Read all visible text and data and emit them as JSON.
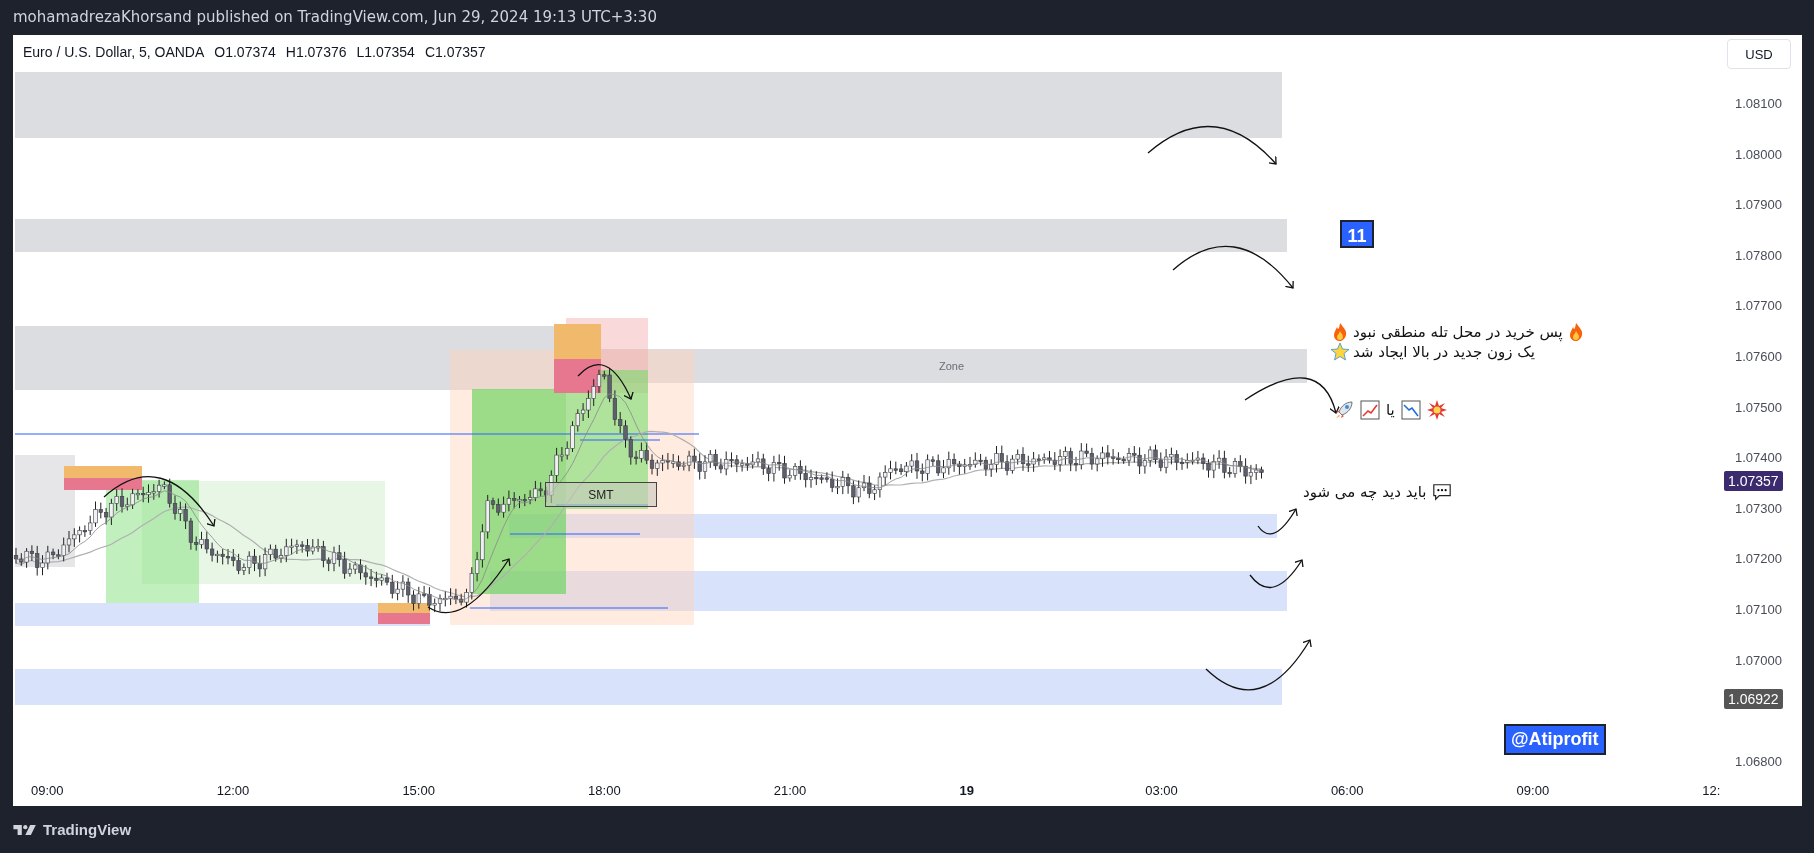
{
  "header": {
    "text": "mohamadrezaKhorsand published on TradingView.com, Jun 29, 2024 19:13 UTC+3:30"
  },
  "legend": {
    "symbol": "Euro / U.S. Dollar, 5, OANDA",
    "ohlc": [
      "O1.07374",
      "H1.07376",
      "L1.07354",
      "C1.07357"
    ]
  },
  "currency_button": "USD",
  "zone_label": "Zone",
  "smt_label": "SMT",
  "annotations": {
    "count_badge": "11",
    "line_1": "پس خرید در محل تله منطقی نبود",
    "line_2": "یک زون جدید در بالا ایجاد شد",
    "or_word": "یا",
    "line_4": "باید دید چه می شود",
    "handle": "@Atiprofit"
  },
  "price_axis": [
    "1.08100",
    "1.08000",
    "1.07900",
    "1.07800",
    "1.07700",
    "1.07600",
    "1.07500",
    "1.07400",
    "1.07300",
    "1.07200",
    "1.07100",
    "1.07000",
    "1.06800"
  ],
  "price_badges": [
    {
      "label": "1.07357",
      "color": "#3b2a6e"
    },
    {
      "label": "1.06922",
      "color": "#555555"
    }
  ],
  "time_axis": [
    {
      "label": "09:00",
      "kind": "time"
    },
    {
      "label": "12:00",
      "kind": "time"
    },
    {
      "label": "15:00",
      "kind": "time"
    },
    {
      "label": "18:00",
      "kind": "time"
    },
    {
      "label": "21:00",
      "kind": "time"
    },
    {
      "label": "19",
      "kind": "day"
    },
    {
      "label": "03:00",
      "kind": "time"
    },
    {
      "label": "06:00",
      "kind": "time"
    },
    {
      "label": "09:00",
      "kind": "time"
    },
    {
      "label": "12:",
      "kind": "time"
    }
  ],
  "footer": {
    "brand": "TradingView"
  }
}
